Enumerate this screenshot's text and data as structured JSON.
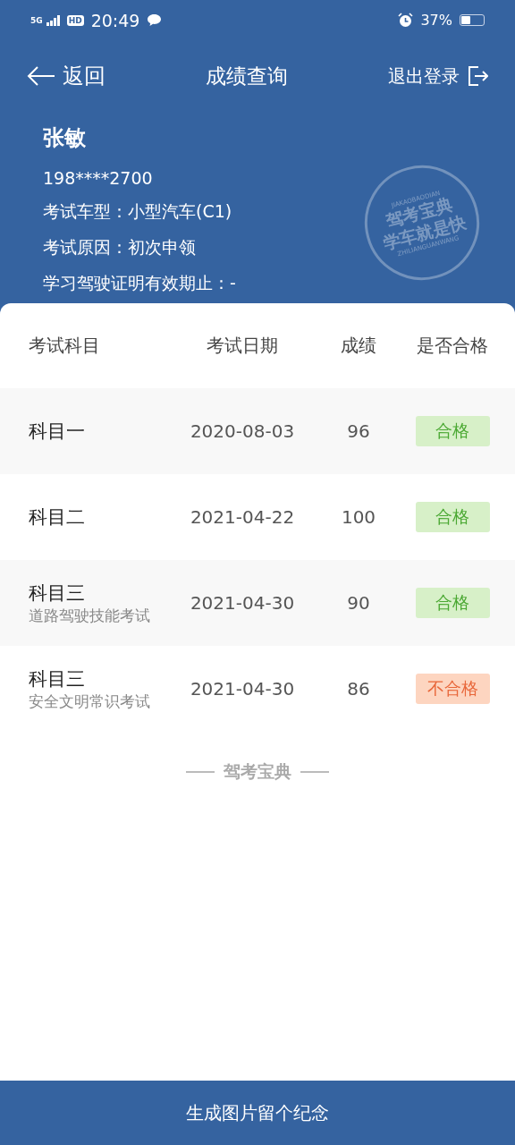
{
  "status_bar": {
    "network": "5G",
    "hd": "HD",
    "time": "20:49",
    "battery_percent": "37%"
  },
  "nav": {
    "back": "返回",
    "title": "成绩查询",
    "logout": "退出登录"
  },
  "profile": {
    "name": "张敏",
    "phone": "198****2700",
    "info": [
      {
        "label": "考试车型：",
        "value": "小型汽车(C1)"
      },
      {
        "label": "考试原因：",
        "value": "初次申领"
      },
      {
        "label": "学习驾驶证明有效期止：",
        "value": "-"
      }
    ]
  },
  "stamp": {
    "top_text": "JIAKAOBAODIAN",
    "line_1": "驾考宝典",
    "line_2": "学车就是快",
    "bottom_text": "ZHILIANGUANWANG"
  },
  "table": {
    "columns": [
      "考试科目",
      "考试日期",
      "成绩",
      "是否合格"
    ],
    "rows": [
      {
        "subject": "科目一",
        "date": "2020-08-03",
        "score": "96",
        "result": "合格",
        "passed": true
      },
      {
        "subject": "科目二",
        "date": "2021-04-22",
        "score": "100",
        "result": "合格",
        "passed": true
      },
      {
        "subject": "科目三",
        "subtitle": "道路驾驶技能考试",
        "date": "2021-04-30",
        "score": "90",
        "result": "合格",
        "passed": true
      },
      {
        "subject": "科目三",
        "subtitle": "安全文明常识考试",
        "date": "2021-04-30",
        "score": "86",
        "result": "不合格",
        "passed": false
      }
    ]
  },
  "brand": "驾考宝典",
  "bottom_button": "生成图片留个纪念"
}
